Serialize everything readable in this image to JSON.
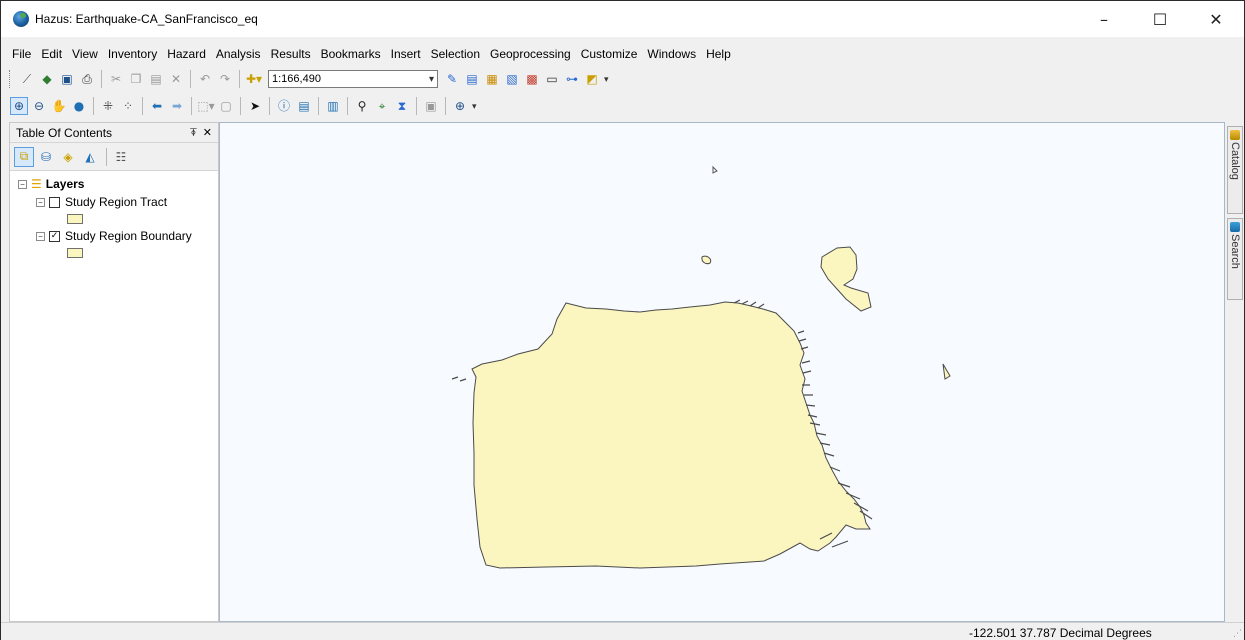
{
  "window": {
    "title": "Hazus: Earthquake-CA_SanFrancisco_eq",
    "controls": {
      "minimize": "–",
      "maximize": "☐",
      "close": "✕"
    }
  },
  "menu": [
    "File",
    "Edit",
    "View",
    "Inventory",
    "Hazard",
    "Analysis",
    "Results",
    "Bookmarks",
    "Insert",
    "Selection",
    "Geoprocessing",
    "Customize",
    "Windows",
    "Help"
  ],
  "standard_toolbar": {
    "scale_value": "1:166,490",
    "icons": [
      "magic-wand-icon",
      "add-data-icon",
      "save-icon",
      "print-icon",
      "cut-icon",
      "copy-icon",
      "paste-icon",
      "delete-icon",
      "undo-icon",
      "redo-icon",
      "add-data-dropdown-icon"
    ]
  },
  "tools_toolbar": {
    "icons": [
      "zoom-in-icon",
      "zoom-out-icon",
      "pan-icon",
      "full-extent-icon",
      "fixed-zoom-in-icon",
      "fixed-zoom-out-icon",
      "back-icon",
      "forward-icon",
      "select-features-icon",
      "clear-selection-icon",
      "select-elements-icon",
      "identify-icon",
      "html-popup-icon",
      "measure-icon",
      "find-icon",
      "goto-xy-icon",
      "time-slider-icon",
      "create-viewer-icon"
    ]
  },
  "toc": {
    "title": "Table Of Contents",
    "pin_glyph": "⍕",
    "close_glyph": "✕",
    "root_label": "Layers",
    "layers": [
      {
        "label": "Study Region Tract",
        "checked": false,
        "swatch": "#fbf5c0"
      },
      {
        "label": "Study Region Boundary",
        "checked": true,
        "swatch": "#fbf5c0"
      }
    ]
  },
  "side_tabs": {
    "catalog": "Catalog",
    "search": "Search"
  },
  "map": {
    "fill": "#fbf5c0",
    "stroke": "#4a4a4a"
  },
  "status": {
    "coordinates": "-122.501  37.787 Decimal Degrees"
  }
}
